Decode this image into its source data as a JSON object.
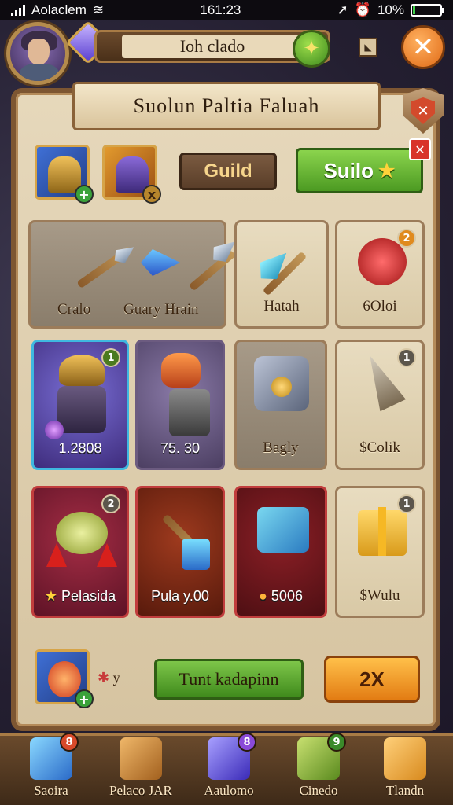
{
  "status_bar": {
    "carrier": "Aolaclem",
    "time": "161:23",
    "battery": "10%",
    "battery_level": 0.1
  },
  "header": {
    "player_name": "Ioh clado",
    "plus_icon": "plus-icon",
    "close_icon": "close-icon"
  },
  "panel": {
    "title": "Suolun Paltia Faluah",
    "guild_button": "Guild",
    "suilo_button": "Suilo",
    "equipment": [
      {
        "name": "helmet-slot",
        "badge": "+"
      },
      {
        "name": "armor-slot",
        "badge": "x"
      }
    ]
  },
  "cards": [
    {
      "label": "Cralo",
      "label2": "Guary Hrain",
      "badge": ""
    },
    {
      "label": "Hatah",
      "badge": ""
    },
    {
      "label": "6Oloi",
      "badge": "2"
    },
    {
      "label": "1.2808",
      "badge": "1"
    },
    {
      "label": "75. 30",
      "badge": ""
    },
    {
      "label": "Bagly",
      "badge": ""
    },
    {
      "label": "$Colik",
      "badge": "1"
    },
    {
      "label": "Pelasida",
      "badge": "2"
    },
    {
      "label": "Pula y.00",
      "badge": ""
    },
    {
      "label": "5006",
      "badge": ""
    },
    {
      "label": "$Wulu",
      "badge": "1"
    }
  ],
  "action_bar": {
    "label": "y",
    "field": "Tunt kadapinn",
    "multiplier": "2X"
  },
  "nav": [
    {
      "label": "Saoira",
      "badge": "8"
    },
    {
      "label": "Pelaco JAR",
      "badge": ""
    },
    {
      "label": "Aaulomo",
      "badge": "8"
    },
    {
      "label": "Cinedo",
      "badge": "9"
    },
    {
      "label": "Tlandn",
      "badge": ""
    }
  ],
  "colors": {
    "accent_green": "#4c9a22",
    "accent_orange": "#e27b12",
    "panel_parchment": "#e6d8bb",
    "frame_brown": "#7d5632"
  }
}
